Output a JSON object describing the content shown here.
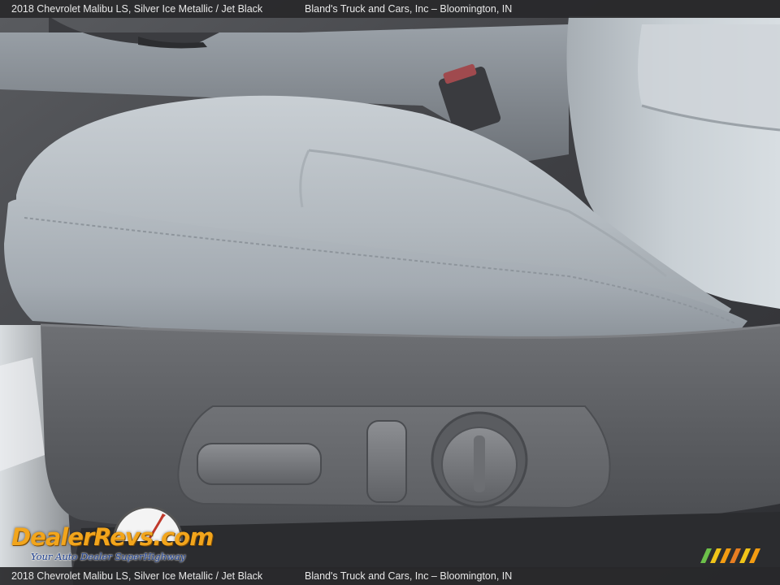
{
  "caption": {
    "vehicle": "2018 Chevrolet Malibu LS,  Silver Ice Metallic / Jet Black",
    "dealer": "Bland's Truck and Cars, Inc – Bloomington, IN"
  },
  "watermark": {
    "brand": "DealerRevs.com",
    "tagline": "Your Auto Dealer SuperHighway"
  },
  "colors": {
    "caption_bar": "#28282a",
    "seat_fabric": "#b5bcc2",
    "seat_trim": "#5c5e62",
    "logo_orange": "#f2a51c",
    "logo_blue": "#1d3f8f"
  }
}
